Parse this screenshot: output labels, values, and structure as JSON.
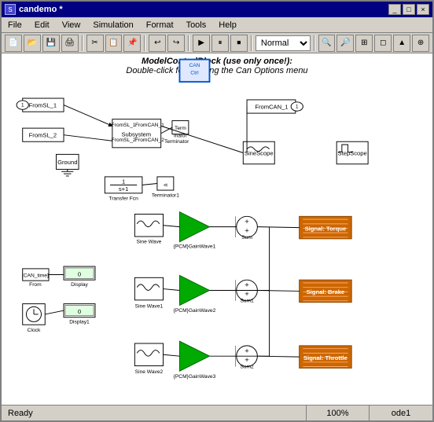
{
  "window": {
    "title": "candemo *",
    "icon": "sim-icon"
  },
  "titleControls": {
    "minimize": "_",
    "maximize": "□",
    "close": "×"
  },
  "menu": {
    "items": [
      "File",
      "Edit",
      "View",
      "Simulation",
      "Format",
      "Tools",
      "Help"
    ]
  },
  "toolbar": {
    "normalLabel": "Normal",
    "buttons": [
      "new",
      "open",
      "save",
      "print",
      "cut",
      "copy",
      "paste",
      "undo",
      "redo",
      "start",
      "pause",
      "stop",
      "zoom-in",
      "zoom-out",
      "fit"
    ]
  },
  "header": {
    "line1": "ModelControlBlock (use only once!):",
    "line2": "Double-click for opening the Can Options menu"
  },
  "blocks": {
    "fromSL1": "FromSL_1",
    "fromSL2": "FromSL_2",
    "fromCAN1": "FromCAN_1",
    "fromCAN2": "FromCAN_2",
    "ground": "Ground",
    "subsystem": "Subsystem",
    "terminator": "Terminator",
    "terminator1": "Terminator1",
    "transferFcn": "Transfer Fcn",
    "sineWave": "Sine Wave",
    "sineWave1": "Sine Wave1",
    "sineWave2": "Sine Wave2",
    "gainWave1": "{PCM}GainWave1",
    "gainWave2": "{PCM}GainWave2",
    "gainWave3": "{PCM}GainWave3",
    "sum": "Sum",
    "sum1": "Sum1",
    "sum2": "Sum2",
    "signalTorque": "Signal: Torque",
    "signalBrake": "Signal: Brake",
    "signalThrottle": "Signal: Throttle",
    "sineScope": "SineScope",
    "stepScope": "StepScope",
    "from": "From",
    "canTime": "[CAN_time]",
    "display": "Display",
    "display1": "Display1",
    "clock": "Clock",
    "fromCAN1Label": "FromCAN_1"
  },
  "status": {
    "ready": "Ready",
    "zoom": "100%",
    "solver": "ode1"
  }
}
